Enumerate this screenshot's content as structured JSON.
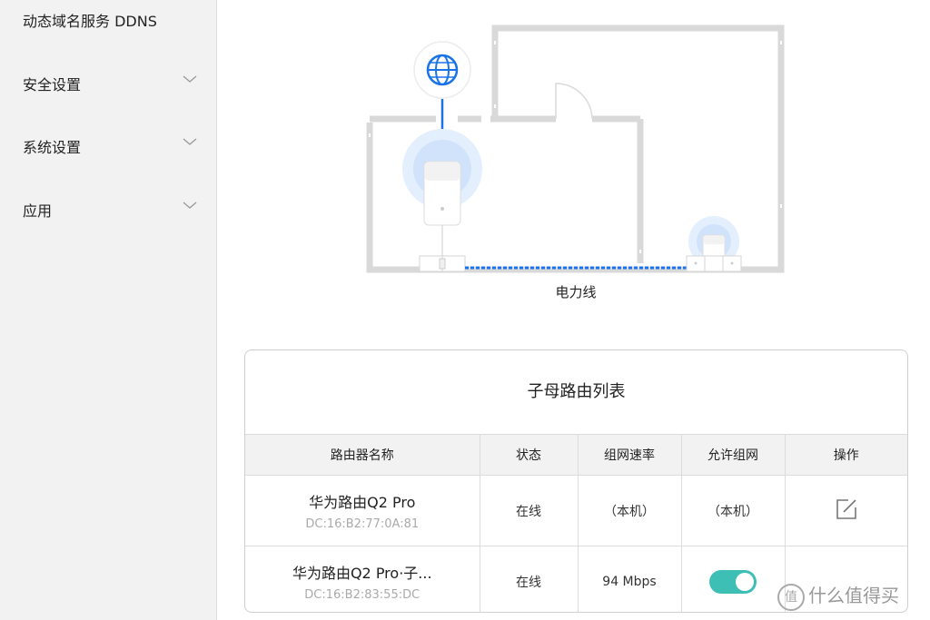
{
  "sidebar": {
    "items": [
      {
        "label": "动态域名服务 DDNS",
        "has_chevron": false
      },
      {
        "label": "安全设置",
        "has_chevron": true
      },
      {
        "label": "系统设置",
        "has_chevron": true
      },
      {
        "label": "应用",
        "has_chevron": true
      }
    ]
  },
  "diagram": {
    "power_line_label": "电力线",
    "colors": {
      "link": "#1a73e8",
      "wall": "#d9d9d9"
    }
  },
  "router_list": {
    "title": "子母路由列表",
    "columns": [
      "路由器名称",
      "状态",
      "组网速率",
      "允许组网",
      "操作"
    ],
    "rows": [
      {
        "name": "华为路由Q2 Pro",
        "mac": "DC:16:B2:77:0A:81",
        "status": "在线",
        "rate": "（本机）",
        "allow": "（本机）",
        "action": "edit-icon"
      },
      {
        "name": "华为路由Q2 Pro·子...",
        "mac": "DC:16:B2:83:55:DC",
        "status": "在线",
        "rate": "94 Mbps",
        "allow_toggle": true
      }
    ]
  },
  "watermark": {
    "text": "什么值得买",
    "badge": "值"
  },
  "accent_color": "#3dbfb5"
}
